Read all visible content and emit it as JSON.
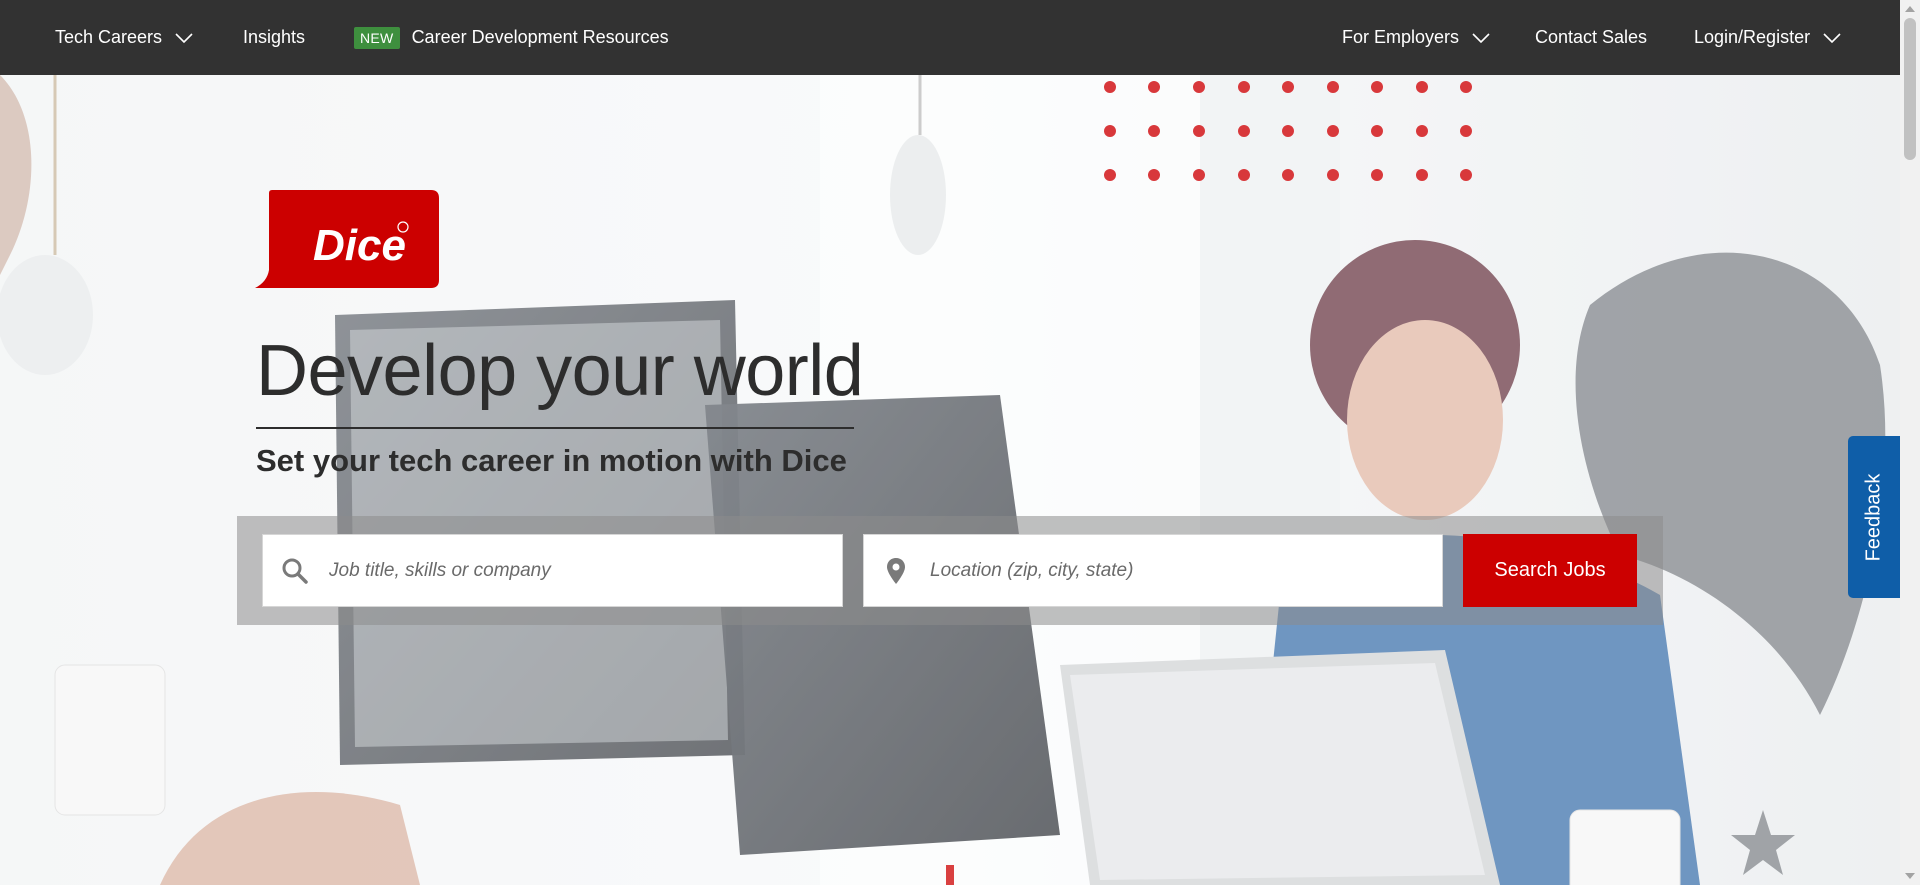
{
  "nav": {
    "tech_careers": "Tech Careers",
    "insights": "Insights",
    "new_badge": "NEW",
    "career_resources": "Career Development Resources",
    "for_employers": "For Employers",
    "contact_sales": "Contact Sales",
    "login_register": "Login/Register"
  },
  "hero": {
    "logo_text": "Dice",
    "headline": "Develop your world",
    "subheadline": "Set your tech career in motion with Dice"
  },
  "search": {
    "keyword_placeholder": "Job title, skills or company",
    "location_placeholder": "Location (zip, city, state)",
    "button_label": "Search Jobs"
  },
  "feedback_label": "Feedback",
  "colors": {
    "nav_bg": "#323232",
    "brand_red": "#cc0000",
    "new_badge_green": "#3e8f3e",
    "feedback_blue": "#0f5ea8"
  },
  "icons": [
    "chevron-down-icon",
    "search-icon",
    "map-pin-icon",
    "registered-mark-icon"
  ]
}
